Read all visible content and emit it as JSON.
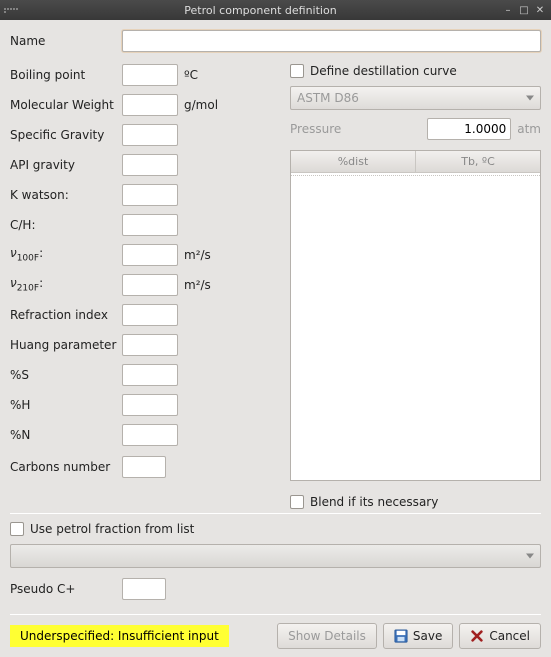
{
  "window": {
    "title": "Petrol component definition"
  },
  "name": {
    "label": "Name",
    "value": ""
  },
  "fields": {
    "boiling_point": {
      "label": "Boiling point",
      "unit": "ºC",
      "value": ""
    },
    "molecular_weight": {
      "label": "Molecular Weight",
      "unit": "g/mol",
      "value": ""
    },
    "specific_gravity": {
      "label": "Specific Gravity",
      "value": ""
    },
    "api_gravity": {
      "label": "API gravity",
      "value": ""
    },
    "k_watson": {
      "label": "K watson:",
      "value": ""
    },
    "c_h": {
      "label": "C/H:",
      "value": ""
    },
    "v100f": {
      "label": "ν₁₀₀F:",
      "unit": "m²/s",
      "value": ""
    },
    "v210f": {
      "label": "ν₂₁₀F:",
      "unit": "m²/s",
      "value": ""
    },
    "refraction_index": {
      "label": "Refraction index",
      "value": ""
    },
    "huang_parameter": {
      "label": "Huang parameter",
      "value": ""
    },
    "pct_s": {
      "label": "%S",
      "value": ""
    },
    "pct_h": {
      "label": "%H",
      "value": ""
    },
    "pct_n": {
      "label": "%N",
      "value": ""
    }
  },
  "carbons": {
    "label": "Carbons number",
    "value": ""
  },
  "right": {
    "define_curve_label": "Define destillation curve",
    "method_select": "ASTM D86",
    "pressure_label": "Pressure",
    "pressure_value": "1.0000",
    "pressure_unit": "atm",
    "grid_headers": {
      "dist": "%dist",
      "tb": "Tb, ºC"
    },
    "blend_label": "Blend if its necessary"
  },
  "fraction": {
    "use_label": "Use petrol fraction from list",
    "pseudo_label": "Pseudo C+",
    "pseudo_value": ""
  },
  "footer": {
    "status": "Underspecified: Insufficient input",
    "show_details": "Show Details",
    "save": "Save",
    "cancel": "Cancel"
  }
}
